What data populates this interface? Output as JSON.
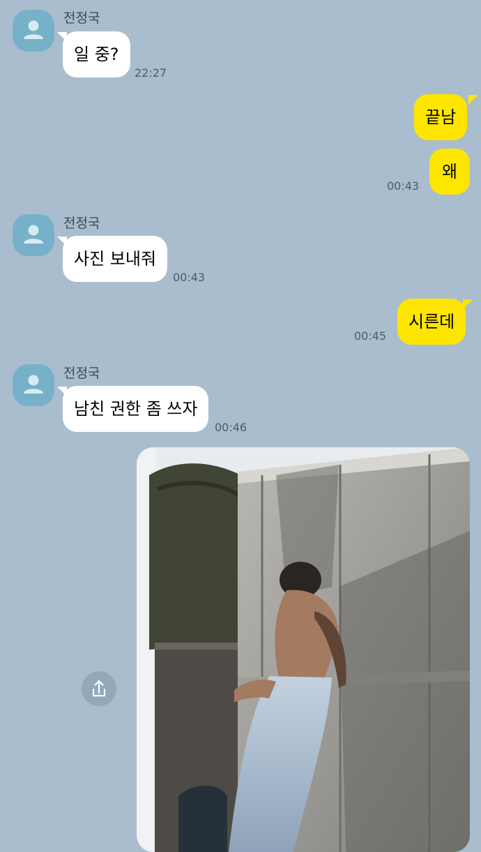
{
  "sender_name": "전정국",
  "messages": [
    {
      "text": "일 중?",
      "time": "22:27"
    },
    {
      "text": "끝남"
    },
    {
      "text": "왜",
      "time": "00:43"
    },
    {
      "text": "사진 보내줘",
      "time": "00:43"
    },
    {
      "text": "시른데",
      "time": "00:45"
    },
    {
      "text": "남친 권한 좀 쓰자",
      "time": "00:46"
    }
  ],
  "icons": {
    "avatar": "person-icon",
    "share": "share-icon"
  },
  "colors": {
    "background": "#a9bdce",
    "incoming": "#ffffff",
    "outgoing": "#fee500",
    "avatar": "#76b1c9"
  }
}
